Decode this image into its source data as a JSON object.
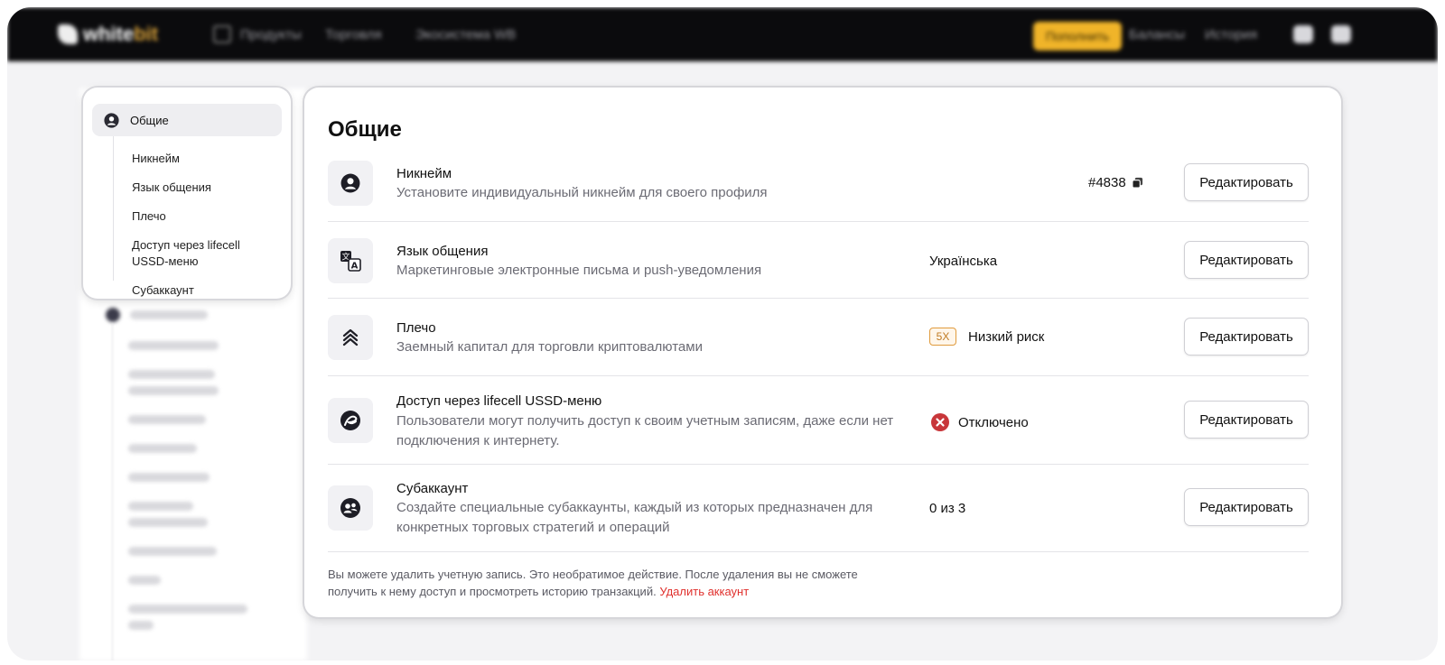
{
  "navbar": {
    "logo_main": "white",
    "logo_accent": "bit",
    "items": [
      "Продукты",
      "Торговля",
      "Экосистема WB"
    ],
    "cta_label": "Пополнить",
    "right_links": [
      "Балансы",
      "История"
    ]
  },
  "sidebar": {
    "active_label": "Общие",
    "sub_items": [
      "Никнейм",
      "Язык общения",
      "Плечо",
      "Доступ через lifecell USSD-меню",
      "Субаккаунт"
    ]
  },
  "main": {
    "title": "Общие",
    "rows": [
      {
        "title": "Никнейм",
        "description": "Установите индивидуальный никнейм для своего профиля",
        "value": "#4838",
        "button": "Редактировать",
        "icon": "user-icon"
      },
      {
        "title": "Язык общения",
        "description": "Маркетинговые электронные письма и push-уведомления",
        "value": "Українська",
        "button": "Редактировать",
        "icon": "translate-icon"
      },
      {
        "title": "Плечо",
        "description": "Заемный капитал для торговли криптовалютами",
        "badge": "5X",
        "value": "Низкий риск",
        "button": "Редактировать",
        "icon": "leverage-icon"
      },
      {
        "title": "Доступ через lifecell USSD-меню",
        "description": "Пользователи могут получить доступ к своим учетным записям, даже если нет подключения к интернету.",
        "value": "Отключено",
        "button": "Редактировать",
        "icon": "lifecell-icon",
        "status_color": "#c8363a"
      },
      {
        "title": "Субаккаунт",
        "description": "Создайте специальные субаккаунты, каждый из которых предназначен для конкретных торговых стратегий и операций",
        "value": "0 из 3",
        "button": "Редактировать",
        "icon": "subaccount-icon"
      }
    ],
    "footer_text": "Вы можете удалить учетную запись. Это необратимое действие. После удаления вы не сможете получить к нему доступ и просмотреть историю транзакций.",
    "delete_link": "Удалить аккаунт"
  },
  "colors": {
    "accent": "#f0b429",
    "danger": "#e0312e",
    "badge_orange": "#e09b3d"
  }
}
